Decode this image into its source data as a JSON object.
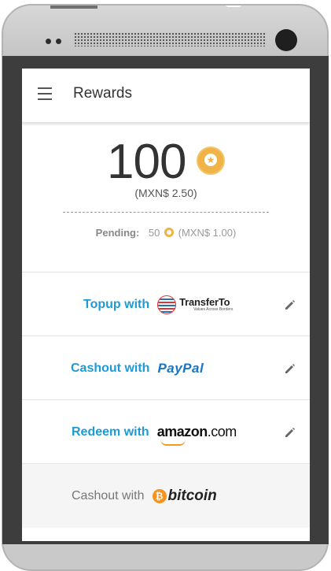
{
  "app_bar": {
    "title": "Rewards"
  },
  "balance": {
    "points": "100",
    "money": "(MXN$ 2.50)"
  },
  "pending": {
    "label": "Pending:",
    "points": "50",
    "money": "(MXN$ 1.00)"
  },
  "options": [
    {
      "label": "Topup with",
      "logo": "TransferTo",
      "logo_tagline": "Values Across Borders",
      "icon": "edit-icon"
    },
    {
      "label": "Cashout with",
      "logo": "PayPal",
      "icon": "edit-icon"
    },
    {
      "label": "Redeem with",
      "logo_main": "amazon",
      "logo_suffix": ".com",
      "icon": "edit-icon"
    },
    {
      "label": "Cashout with",
      "logo": "bitcoin",
      "logo_symbol": "₿"
    }
  ],
  "colors": {
    "accent": "#1e9ad6",
    "coin": "#f0b347",
    "paypal": "#1a74c4",
    "amazon_smile": "#f29b1d",
    "bitcoin": "#f7931a"
  }
}
